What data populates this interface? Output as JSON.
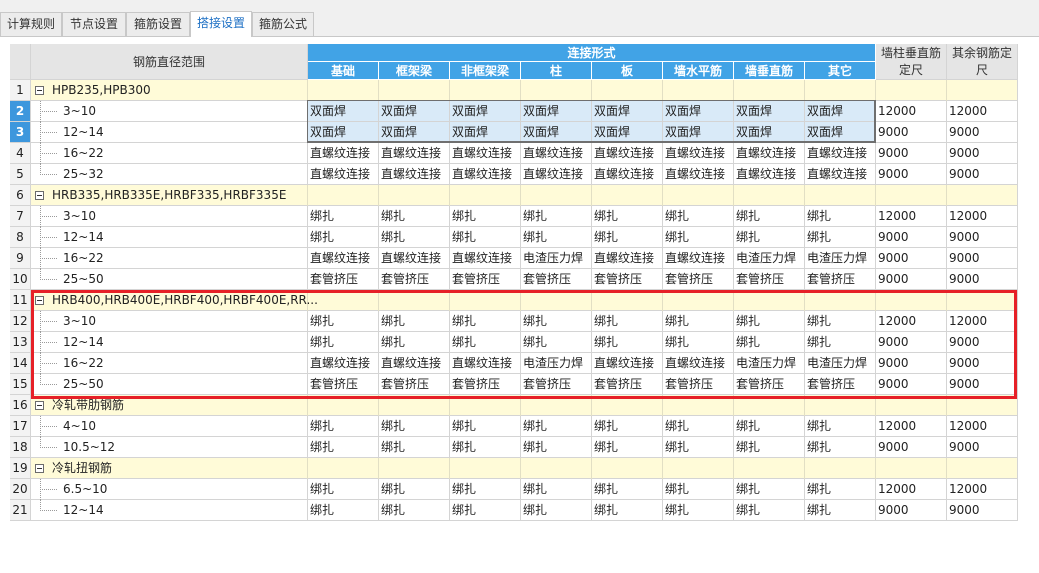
{
  "tabs": [
    "计算规则",
    "节点设置",
    "箍筋设置",
    "搭接设置",
    "箍筋公式"
  ],
  "active_tab": 3,
  "header": {
    "range": "钢筋直径范围",
    "conn_group": "连接形式",
    "cols": [
      "基础",
      "框架梁",
      "非框架梁",
      "柱",
      "板",
      "墙水平筋",
      "墙垂直筋",
      "其它"
    ],
    "wall_len": [
      "墙柱垂直筋",
      "定尺"
    ],
    "other_len": [
      "其余钢筋定",
      "尺"
    ]
  },
  "rows": [
    {
      "num": "1",
      "type": "group",
      "name": "HPB235,HPB300"
    },
    {
      "num": "2",
      "type": "data",
      "range": "3~10",
      "conn": [
        "双面焊",
        "双面焊",
        "双面焊",
        "双面焊",
        "双面焊",
        "双面焊",
        "双面焊",
        "双面焊"
      ],
      "wall": "12000",
      "other": "12000",
      "selected": true
    },
    {
      "num": "3",
      "type": "data",
      "range": "12~14",
      "conn": [
        "双面焊",
        "双面焊",
        "双面焊",
        "双面焊",
        "双面焊",
        "双面焊",
        "双面焊",
        "双面焊"
      ],
      "wall": "9000",
      "other": "9000",
      "selected": true
    },
    {
      "num": "4",
      "type": "data",
      "range": "16~22",
      "conn": [
        "直螺纹连接",
        "直螺纹连接",
        "直螺纹连接",
        "直螺纹连接",
        "直螺纹连接",
        "直螺纹连接",
        "直螺纹连接",
        "直螺纹连接"
      ],
      "wall": "9000",
      "other": "9000"
    },
    {
      "num": "5",
      "type": "data",
      "range": "25~32",
      "conn": [
        "直螺纹连接",
        "直螺纹连接",
        "直螺纹连接",
        "直螺纹连接",
        "直螺纹连接",
        "直螺纹连接",
        "直螺纹连接",
        "直螺纹连接"
      ],
      "wall": "9000",
      "other": "9000"
    },
    {
      "num": "6",
      "type": "group",
      "name": "HRB335,HRB335E,HRBF335,HRBF335E"
    },
    {
      "num": "7",
      "type": "data",
      "range": "3~10",
      "conn": [
        "绑扎",
        "绑扎",
        "绑扎",
        "绑扎",
        "绑扎",
        "绑扎",
        "绑扎",
        "绑扎"
      ],
      "wall": "12000",
      "other": "12000"
    },
    {
      "num": "8",
      "type": "data",
      "range": "12~14",
      "conn": [
        "绑扎",
        "绑扎",
        "绑扎",
        "绑扎",
        "绑扎",
        "绑扎",
        "绑扎",
        "绑扎"
      ],
      "wall": "9000",
      "other": "9000"
    },
    {
      "num": "9",
      "type": "data",
      "range": "16~22",
      "conn": [
        "直螺纹连接",
        "直螺纹连接",
        "直螺纹连接",
        "电渣压力焊",
        "直螺纹连接",
        "直螺纹连接",
        "电渣压力焊",
        "电渣压力焊"
      ],
      "wall": "9000",
      "other": "9000"
    },
    {
      "num": "10",
      "type": "data",
      "range": "25~50",
      "conn": [
        "套管挤压",
        "套管挤压",
        "套管挤压",
        "套管挤压",
        "套管挤压",
        "套管挤压",
        "套管挤压",
        "套管挤压"
      ],
      "wall": "9000",
      "other": "9000"
    },
    {
      "num": "11",
      "type": "group",
      "name": "HRB400,HRB400E,HRBF400,HRBF400E,RR..."
    },
    {
      "num": "12",
      "type": "data",
      "range": "3~10",
      "conn": [
        "绑扎",
        "绑扎",
        "绑扎",
        "绑扎",
        "绑扎",
        "绑扎",
        "绑扎",
        "绑扎"
      ],
      "wall": "12000",
      "other": "12000"
    },
    {
      "num": "13",
      "type": "data",
      "range": "12~14",
      "conn": [
        "绑扎",
        "绑扎",
        "绑扎",
        "绑扎",
        "绑扎",
        "绑扎",
        "绑扎",
        "绑扎"
      ],
      "wall": "9000",
      "other": "9000"
    },
    {
      "num": "14",
      "type": "data",
      "range": "16~22",
      "conn": [
        "直螺纹连接",
        "直螺纹连接",
        "直螺纹连接",
        "电渣压力焊",
        "直螺纹连接",
        "直螺纹连接",
        "电渣压力焊",
        "电渣压力焊"
      ],
      "wall": "9000",
      "other": "9000"
    },
    {
      "num": "15",
      "type": "data",
      "range": "25~50",
      "conn": [
        "套管挤压",
        "套管挤压",
        "套管挤压",
        "套管挤压",
        "套管挤压",
        "套管挤压",
        "套管挤压",
        "套管挤压"
      ],
      "wall": "9000",
      "other": "9000"
    },
    {
      "num": "16",
      "type": "group",
      "name": "冷轧带肋钢筋"
    },
    {
      "num": "17",
      "type": "data",
      "range": "4~10",
      "conn": [
        "绑扎",
        "绑扎",
        "绑扎",
        "绑扎",
        "绑扎",
        "绑扎",
        "绑扎",
        "绑扎"
      ],
      "wall": "12000",
      "other": "12000"
    },
    {
      "num": "18",
      "type": "data",
      "range": "10.5~12",
      "conn": [
        "绑扎",
        "绑扎",
        "绑扎",
        "绑扎",
        "绑扎",
        "绑扎",
        "绑扎",
        "绑扎"
      ],
      "wall": "9000",
      "other": "9000"
    },
    {
      "num": "19",
      "type": "group",
      "name": "冷轧扭钢筋"
    },
    {
      "num": "20",
      "type": "data",
      "range": "6.5~10",
      "conn": [
        "绑扎",
        "绑扎",
        "绑扎",
        "绑扎",
        "绑扎",
        "绑扎",
        "绑扎",
        "绑扎"
      ],
      "wall": "12000",
      "other": "12000"
    },
    {
      "num": "21",
      "type": "data",
      "range": "12~14",
      "conn": [
        "绑扎",
        "绑扎",
        "绑扎",
        "绑扎",
        "绑扎",
        "绑扎",
        "绑扎",
        "绑扎"
      ],
      "wall": "9000",
      "other": "9000"
    }
  ],
  "colors": {
    "header_blue": "#41a3e6",
    "group_row": "#fffbd8",
    "selected_rownum": "#3d97dd",
    "selected_cell": "#d9eaf8",
    "highlight_box": "#e62027"
  }
}
